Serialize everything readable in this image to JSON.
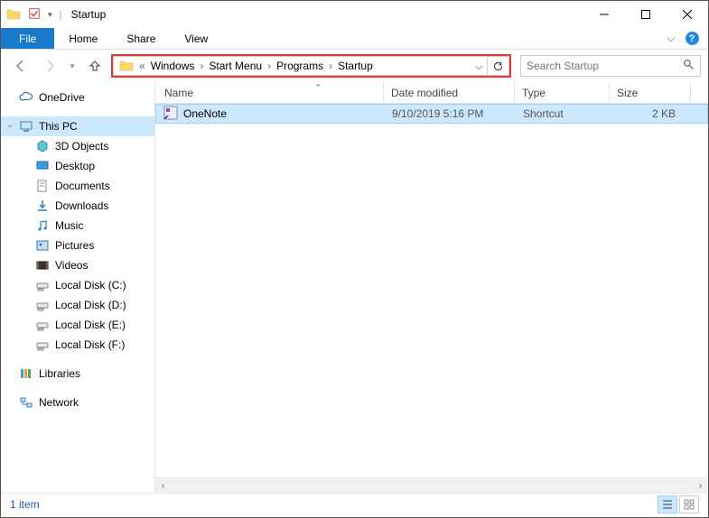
{
  "title": "Startup",
  "ribbon": {
    "file": "File",
    "tabs": [
      "Home",
      "Share",
      "View"
    ]
  },
  "breadcrumb": [
    "Windows",
    "Start Menu",
    "Programs",
    "Startup"
  ],
  "search_placeholder": "Search Startup",
  "columns": {
    "name": "Name",
    "date": "Date modified",
    "type": "Type",
    "size": "Size"
  },
  "rows": [
    {
      "name": "OneNote",
      "date": "9/10/2019 5:16 PM",
      "type": "Shortcut",
      "size": "2 KB"
    }
  ],
  "tree": {
    "onedrive": "OneDrive",
    "thispc": "This PC",
    "children": [
      "3D Objects",
      "Desktop",
      "Documents",
      "Downloads",
      "Music",
      "Pictures",
      "Videos",
      "Local Disk (C:)",
      "Local Disk (D:)",
      "Local Disk  (E:)",
      "Local Disk (F:)"
    ],
    "libraries": "Libraries",
    "network": "Network"
  },
  "status": "1 item"
}
